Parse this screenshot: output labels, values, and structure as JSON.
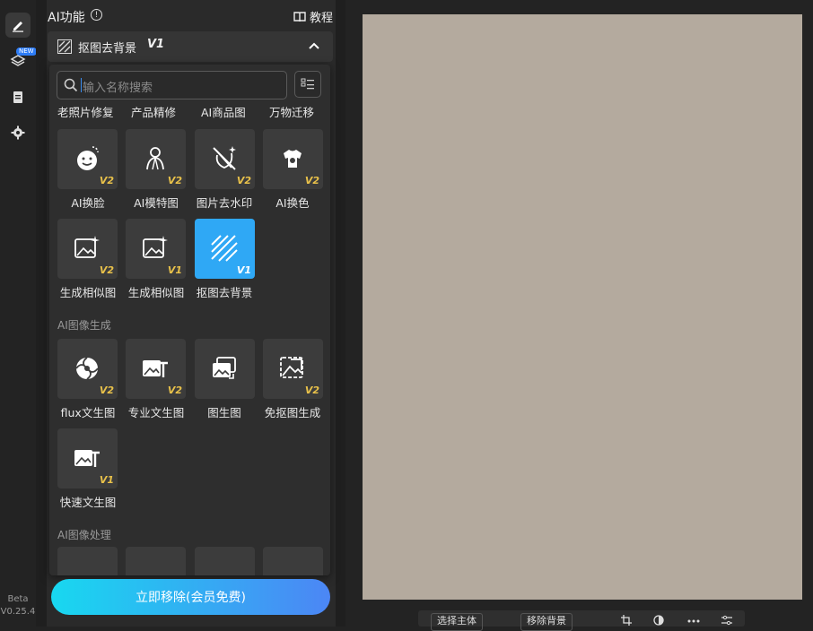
{
  "rail": {
    "new_badge": "NEW",
    "version_line1": "Beta",
    "version_line2": "V0.25.4"
  },
  "ai_panel": {
    "title": "AI功能",
    "tutorial_label": "教程",
    "section": {
      "label": "抠图去背景",
      "version": "V1"
    }
  },
  "popup": {
    "search_placeholder": "输入名称搜索",
    "top_row": [
      "老照片修复",
      "产品精修",
      "AI商品图",
      "万物迁移"
    ],
    "tiles_row1": [
      {
        "label": "AI换脸",
        "version": "V2",
        "icon": "face-swap-icon"
      },
      {
        "label": "AI模特图",
        "version": "V2",
        "icon": "model-icon"
      },
      {
        "label": "图片去水印",
        "version": "V2",
        "icon": "watermark-remove-icon"
      },
      {
        "label": "AI换色",
        "version": "V2",
        "icon": "recolor-icon"
      }
    ],
    "tiles_row2": [
      {
        "label": "生成相似图",
        "version": "V2",
        "icon": "similar-image-icon"
      },
      {
        "label": "生成相似图",
        "version": "V1",
        "icon": "similar-image-icon"
      },
      {
        "label": "抠图去背景",
        "version": "V1",
        "icon": "cutout-icon",
        "selected": true
      }
    ],
    "category_generate": "AI图像生成",
    "tiles_row3": [
      {
        "label": "flux文生图",
        "version": "V2",
        "icon": "flux-icon"
      },
      {
        "label": "专业文生图",
        "version": "V2",
        "icon": "text-to-image-icon"
      },
      {
        "label": "图生图",
        "version": "",
        "icon": "image-to-image-icon"
      },
      {
        "label": "免抠图生成",
        "version": "V2",
        "icon": "no-cutout-icon"
      }
    ],
    "tiles_row4": [
      {
        "label": "快速文生图",
        "version": "V1",
        "icon": "text-to-image-icon"
      }
    ],
    "category_process": "AI图像处理"
  },
  "cta_label": "立即移除(会员免费)",
  "toolbar": {
    "select_subject": "选择主体",
    "remove_bg": "移除背景"
  },
  "colors": {
    "accent": "#2fa8f5",
    "badge": "#e8c14a",
    "cta_start": "#18d8f0",
    "cta_end": "#4c86f5"
  }
}
